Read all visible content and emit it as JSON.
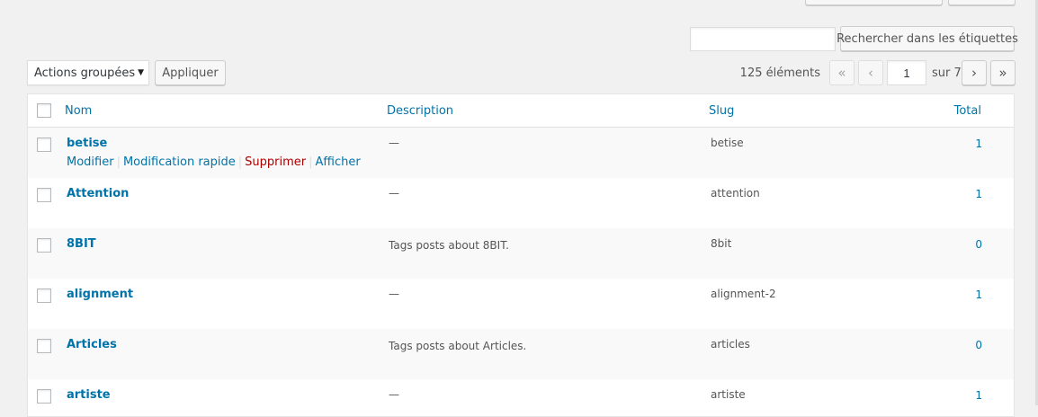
{
  "top_buttons": [
    "",
    ""
  ],
  "search": {
    "value": "",
    "placeholder": "",
    "button_label": "Rechercher dans les étiquettes"
  },
  "bulk": {
    "selected": "Actions groupées",
    "apply_label": "Appliquer"
  },
  "pagination": {
    "count_label": "125 éléments",
    "first": "«",
    "prev": "‹",
    "current_page": "1",
    "of_label": "sur 7",
    "next": "›",
    "last": "»"
  },
  "table": {
    "headers": {
      "name": "Nom",
      "description": "Description",
      "slug": "Slug",
      "total": "Total"
    },
    "row_actions": {
      "edit": "Modifier",
      "quick_edit": "Modification rapide",
      "delete": "Supprimer",
      "view": "Afficher"
    },
    "rows": [
      {
        "name": "betise",
        "description": "—",
        "slug": "betise",
        "count": "1"
      },
      {
        "name": "Attention",
        "description": "—",
        "slug": "attention",
        "count": "1"
      },
      {
        "name": "8BIT",
        "description": "Tags posts about 8BIT.",
        "slug": "8bit",
        "count": "0"
      },
      {
        "name": "alignment",
        "description": "—",
        "slug": "alignment-2",
        "count": "1"
      },
      {
        "name": "Articles",
        "description": "Tags posts about Articles.",
        "slug": "articles",
        "count": "0"
      },
      {
        "name": "artiste",
        "description": "—",
        "slug": "artiste",
        "count": "1"
      }
    ]
  },
  "colors": {
    "link": "#0073aa",
    "delete": "#aa0000",
    "background": "#f1f1f1"
  }
}
